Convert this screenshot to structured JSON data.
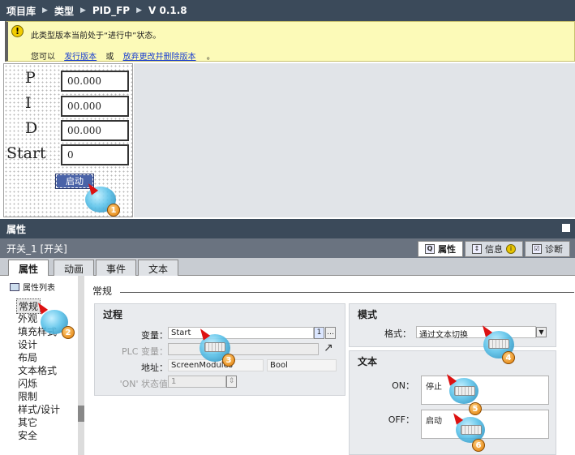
{
  "breadcrumb": [
    "项目库",
    "类型",
    "PID_FP",
    "V 0.1.8"
  ],
  "banner": {
    "message": "此类型版本当前处于“进行中”状态。",
    "prefix": "您可以",
    "link_release": "发行版本",
    "or": "或",
    "link_discard": "放弃更改并删除版本",
    "suffix": "。"
  },
  "screen": {
    "labels": [
      "P",
      "I",
      "D",
      "Start"
    ],
    "values": [
      "00.000",
      "00.000",
      "00.000",
      "0"
    ],
    "button_label": "启动"
  },
  "properties": {
    "title": "属性",
    "object_name": "开关_1 [开关]",
    "view_tabs": [
      "属性",
      "信息",
      "诊断"
    ],
    "tabs": [
      "属性",
      "动画",
      "事件",
      "文本"
    ],
    "nav_header": "属性列表",
    "nav_items": [
      "常规",
      "外观",
      "填充样式",
      "设计",
      "布局",
      "文本格式",
      "闪烁",
      "限制",
      "样式/设计",
      "其它",
      "安全"
    ],
    "section_title": "常规",
    "process": {
      "title": "过程",
      "variable_label": "变量：",
      "variable_value": "Start",
      "plc_label": "PLC 变量：",
      "address_label": "地址：",
      "address_value": "ScreenModules",
      "type_value": "Bool",
      "state_label": "'ON' 状态值",
      "state_value": "1"
    },
    "mode": {
      "title": "模式",
      "format_label": "格式：",
      "format_value": "通过文本切换"
    },
    "text": {
      "title": "文本",
      "on_label": "ON：",
      "on_value": "停止",
      "off_label": "OFF：",
      "off_value": "启动"
    }
  },
  "annotations": [
    "1",
    "2",
    "3",
    "4",
    "5",
    "6"
  ],
  "colors": {
    "title_bar": "#3b4a5a",
    "banner_bg": "#fcfab8",
    "button_bg": "#4a63a8",
    "badge": "#e07b00"
  }
}
